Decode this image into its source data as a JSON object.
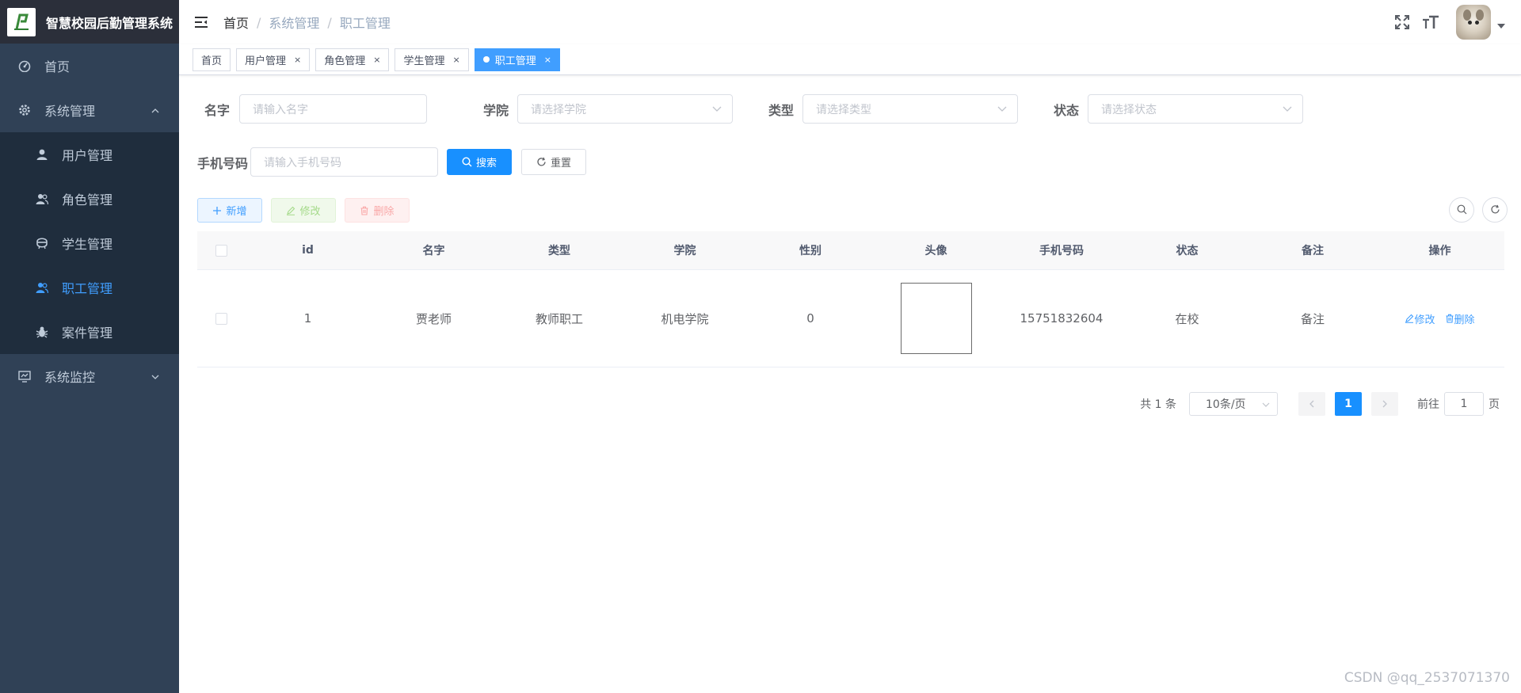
{
  "app": {
    "title": "智慧校园后勤管理系统"
  },
  "sidebar": {
    "home": "首页",
    "system": "系统管理",
    "items": [
      {
        "label": "用户管理",
        "icon": "user-icon"
      },
      {
        "label": "角色管理",
        "icon": "peoples-icon"
      },
      {
        "label": "学生管理",
        "icon": "student-icon"
      },
      {
        "label": "职工管理",
        "icon": "staff-icon",
        "active": true
      },
      {
        "label": "案件管理",
        "icon": "bug-icon"
      }
    ],
    "monitor": "系统监控"
  },
  "breadcrumb": [
    "首页",
    "系统管理",
    "职工管理"
  ],
  "tags": [
    {
      "label": "首页"
    },
    {
      "label": "用户管理"
    },
    {
      "label": "角色管理"
    },
    {
      "label": "学生管理"
    },
    {
      "label": "职工管理",
      "active": true
    }
  ],
  "form": {
    "name_label": "名字",
    "name_placeholder": "请输入名字",
    "college_label": "学院",
    "college_placeholder": "请选择学院",
    "type_label": "类型",
    "type_placeholder": "请选择类型",
    "status_label": "状态",
    "status_placeholder": "请选择状态",
    "phone_label": "手机号码",
    "phone_placeholder": "请输入手机号码",
    "search_btn": "搜索",
    "reset_btn": "重置"
  },
  "toolbar": {
    "add": "新增",
    "edit": "修改",
    "delete": "删除"
  },
  "table": {
    "headers": [
      "id",
      "名字",
      "类型",
      "学院",
      "性别",
      "头像",
      "手机号码",
      "状态",
      "备注",
      "操作"
    ],
    "rows": [
      {
        "id": "1",
        "name": "贾老师",
        "type": "教师职工",
        "college": "机电学院",
        "gender": "0",
        "phone": "15751832604",
        "status": "在校",
        "remark": "备注",
        "edit": "修改",
        "delete": "删除"
      }
    ]
  },
  "pagination": {
    "total": "共 1 条",
    "page_size": "10条/页",
    "current": "1",
    "goto_prefix": "前往",
    "goto_value": "1",
    "goto_suffix": "页"
  },
  "watermark": "CSDN @qq_2537071370",
  "colors": {
    "sidebar": "#304156",
    "submenu": "#1f2d3d",
    "primary": "#1890ff",
    "accent": "#409eff"
  }
}
